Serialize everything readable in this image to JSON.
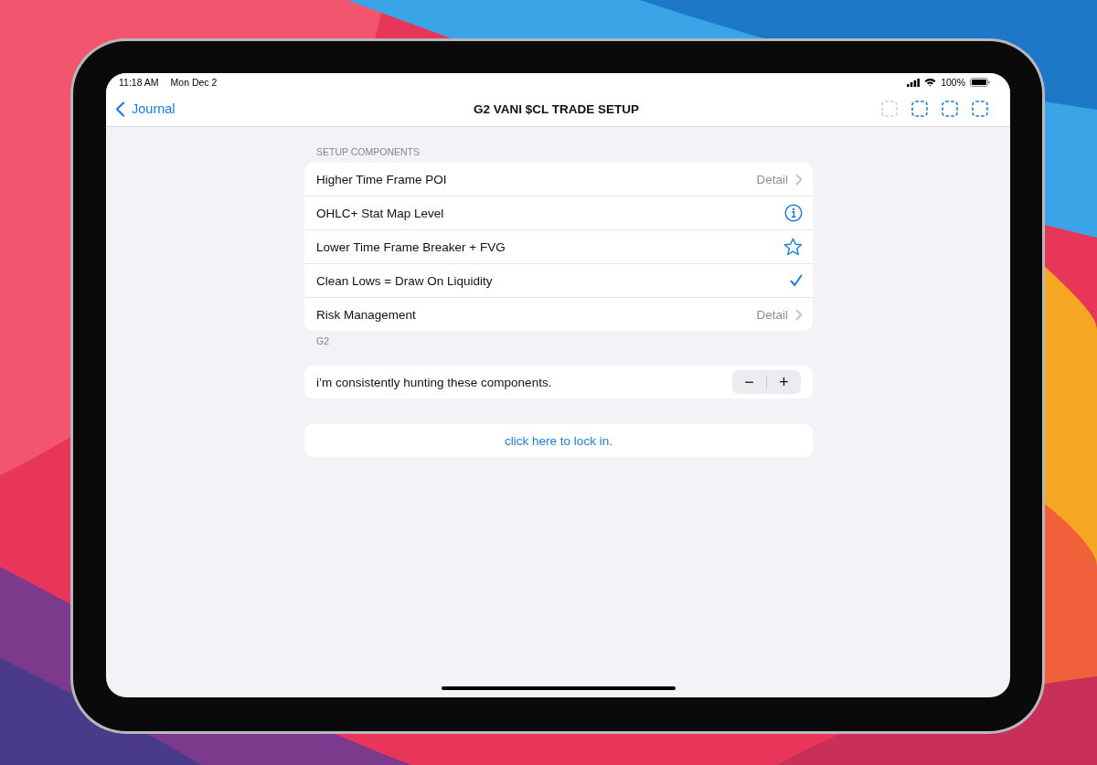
{
  "status_bar": {
    "time": "11:18 AM",
    "date": "Mon Dec 2",
    "battery": "100%"
  },
  "nav": {
    "back": "Journal",
    "title": "G2 VANI $CL TRADE SETUP",
    "toolbar_buttons": [
      {
        "disabled": true
      },
      {
        "disabled": false
      },
      {
        "disabled": false
      },
      {
        "disabled": false
      }
    ]
  },
  "section": {
    "header": "SETUP COMPONENTS",
    "footer": "G2",
    "rows": [
      {
        "label": "Higher Time Frame POI",
        "kind": "detail",
        "detail": "Detail"
      },
      {
        "label": "OHLC+ Stat Map Level",
        "kind": "info"
      },
      {
        "label": "Lower Time Frame Breaker + FVG",
        "kind": "star"
      },
      {
        "label": "Clean Lows = Draw On Liquidity",
        "kind": "check"
      },
      {
        "label": "Risk Management",
        "kind": "detail",
        "detail": "Detail"
      }
    ]
  },
  "stepper_row": {
    "label": "i’m consistently hunting these components.",
    "minus": "−",
    "plus": "+"
  },
  "action": {
    "label": "click here to lock in."
  }
}
